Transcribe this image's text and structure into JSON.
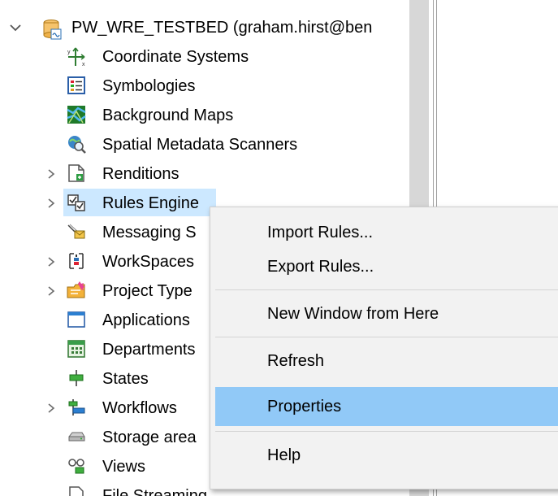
{
  "tree": {
    "root_label": "PW_WRE_TESTBED (graham.hirst@ben",
    "items": [
      {
        "label": "Coordinate Systems",
        "icon": "coordinate-systems-icon",
        "expandable": false
      },
      {
        "label": "Symbologies",
        "icon": "symbologies-icon",
        "expandable": false
      },
      {
        "label": "Background Maps",
        "icon": "background-maps-icon",
        "expandable": false
      },
      {
        "label": "Spatial Metadata Scanners",
        "icon": "spatial-scanner-icon",
        "expandable": false
      },
      {
        "label": "Renditions",
        "icon": "renditions-icon",
        "expandable": true
      },
      {
        "label": "Rules Engine",
        "icon": "rules-engine-icon",
        "expandable": true,
        "selected": true
      },
      {
        "label": "Messaging S",
        "icon": "messaging-icon",
        "expandable": false
      },
      {
        "label": "WorkSpaces",
        "icon": "workspaces-icon",
        "expandable": true
      },
      {
        "label": "Project Type",
        "icon": "project-types-icon",
        "expandable": true
      },
      {
        "label": "Applications",
        "icon": "applications-icon",
        "expandable": false
      },
      {
        "label": "Departments",
        "icon": "departments-icon",
        "expandable": false
      },
      {
        "label": "States",
        "icon": "states-icon",
        "expandable": false
      },
      {
        "label": "Workflows",
        "icon": "workflows-icon",
        "expandable": true
      },
      {
        "label": "Storage area",
        "icon": "storage-areas-icon",
        "expandable": false
      },
      {
        "label": "Views",
        "icon": "views-icon",
        "expandable": false
      },
      {
        "label": "File Streaming",
        "icon": "file-streaming-icon",
        "expandable": false
      }
    ]
  },
  "context_menu": {
    "items": [
      {
        "label": "Import Rules..."
      },
      {
        "label": "Export Rules..."
      },
      {
        "label": "New Window from Here"
      },
      {
        "label": "Refresh"
      },
      {
        "label": "Properties",
        "highlighted": true
      },
      {
        "label": "Help"
      }
    ]
  },
  "colors": {
    "selection": "#cce8ff",
    "menu_highlight": "#91c9f7",
    "menu_background": "#f2f2f2"
  }
}
